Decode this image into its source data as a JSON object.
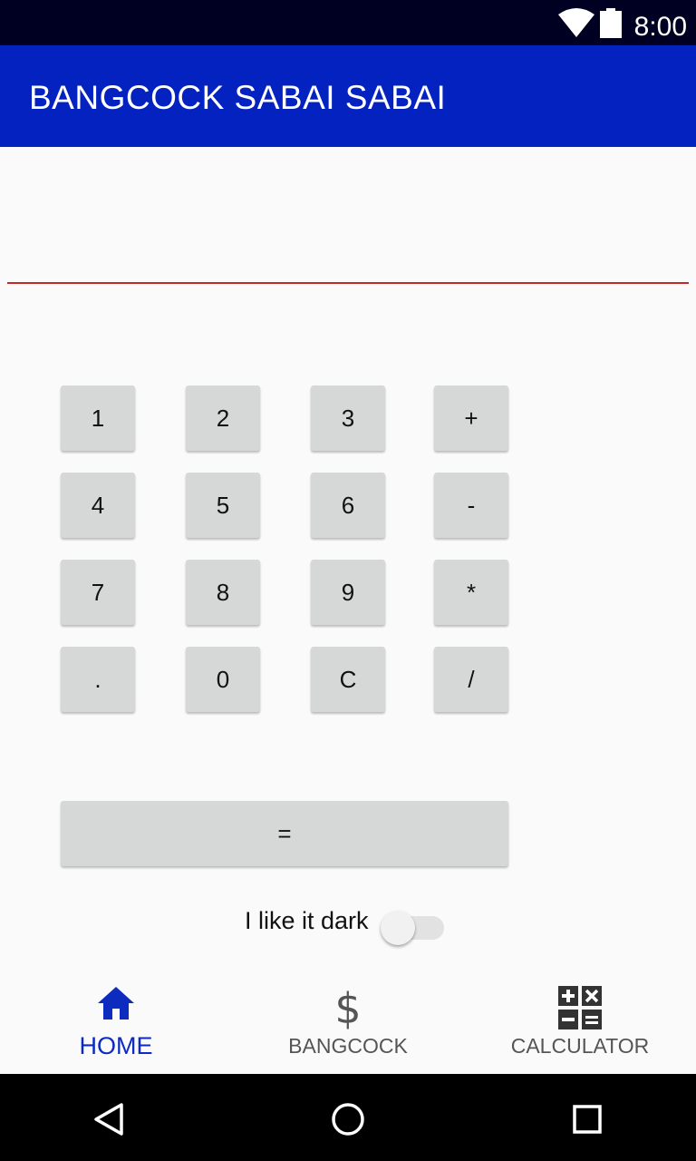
{
  "status_bar": {
    "time": "8:00",
    "icons": [
      "wifi-icon",
      "battery-icon"
    ]
  },
  "app_bar": {
    "title": "BANGCOCK SABAI SABAI"
  },
  "display": {
    "value": ""
  },
  "keypad": {
    "rows": [
      [
        "1",
        "2",
        "3",
        "+"
      ],
      [
        "4",
        "5",
        "6",
        "-"
      ],
      [
        "7",
        "8",
        "9",
        "*"
      ],
      [
        ".",
        "0",
        "C",
        "/"
      ]
    ],
    "equals": "="
  },
  "theme_toggle": {
    "label": "I like it dark",
    "checked": false
  },
  "bottom_nav": {
    "items": [
      {
        "label": "HOME",
        "icon": "home-icon",
        "active": true
      },
      {
        "label": "BANGCOCK",
        "icon": "dollar-icon",
        "active": false
      },
      {
        "label": "CALCULATOR",
        "icon": "calculator-icon",
        "active": false
      }
    ]
  },
  "system_nav": {
    "icons": [
      "back-icon",
      "home-circle-icon",
      "recents-icon"
    ]
  },
  "colors": {
    "app_bar": "#0322bf",
    "accent_active": "#0d2bbf",
    "underline": "#c62828",
    "key_bg": "#d6d7d7"
  }
}
